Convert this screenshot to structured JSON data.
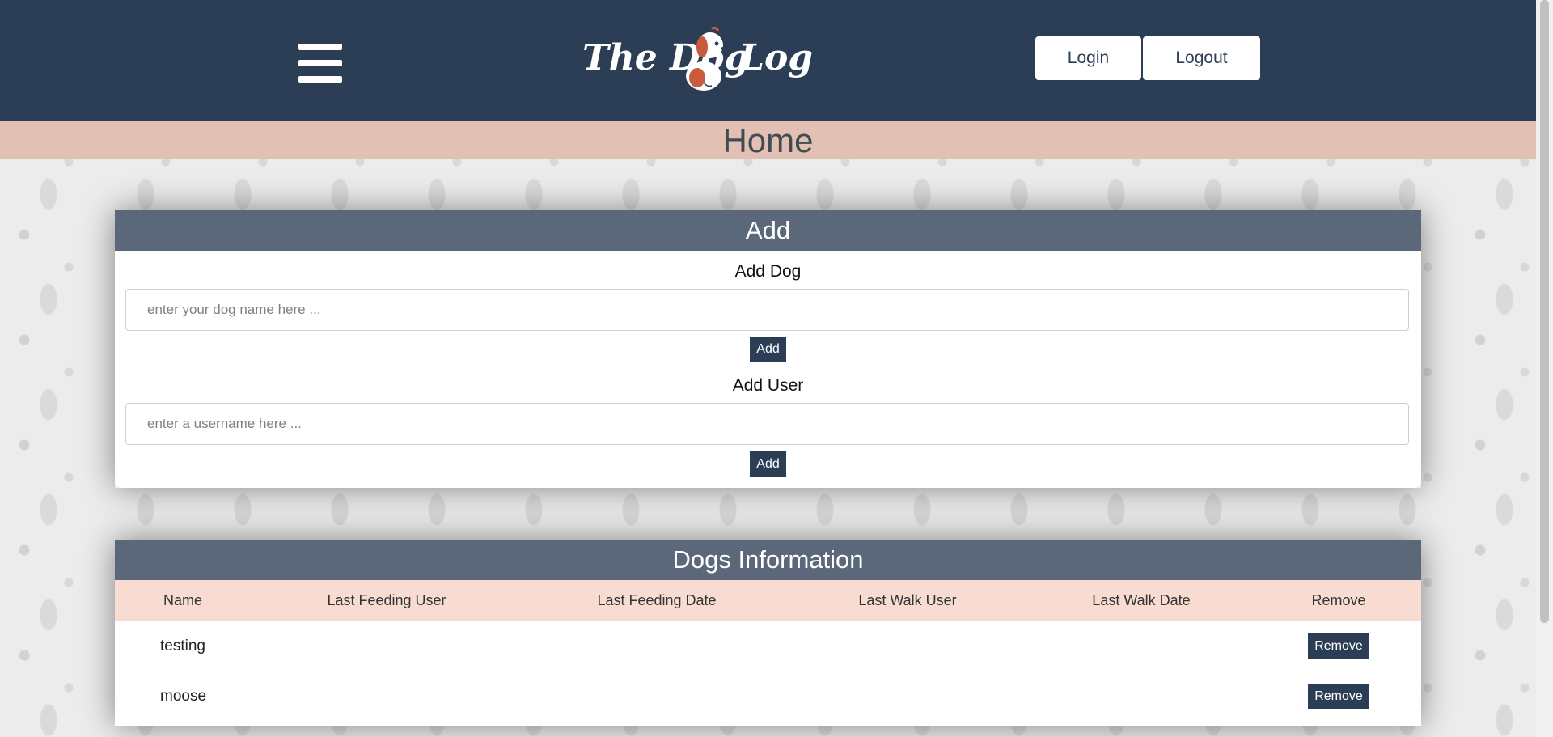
{
  "header": {
    "logo_word1": "The Dog",
    "logo_word2": "Log",
    "login_label": "Login",
    "logout_label": "Logout"
  },
  "page": {
    "title": "Home"
  },
  "add_panel": {
    "title": "Add",
    "add_dog_label": "Add Dog",
    "dog_placeholder": "enter your dog name here ...",
    "add_dog_button": "Add",
    "add_user_label": "Add User",
    "user_placeholder": "enter a username here ...",
    "add_user_button": "Add"
  },
  "dogs_panel": {
    "title": "Dogs Information",
    "columns": [
      "Name",
      "Last Feeding User",
      "Last Feeding Date",
      "Last Walk User",
      "Last Walk Date",
      "Remove"
    ],
    "rows": [
      {
        "name": "testing",
        "remove_label": "Remove"
      },
      {
        "name": "moose",
        "remove_label": "Remove"
      }
    ]
  },
  "colors": {
    "header_bg": "#2c3e55",
    "title_band": "#e2c1b4",
    "panel_head": "#5a687a",
    "table_head": "#f8dcd2",
    "button_bg": "#2c3e55"
  },
  "icons": [
    "hamburger-menu-icon",
    "dog-logo-icon"
  ]
}
